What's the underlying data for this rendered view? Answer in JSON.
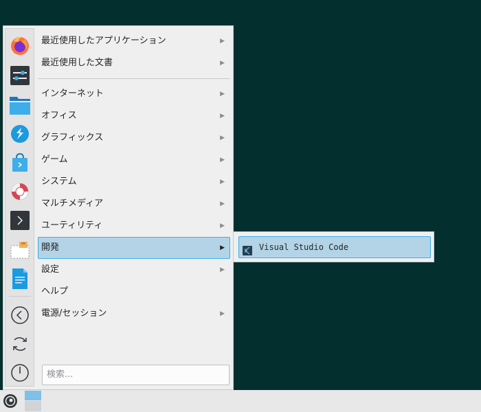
{
  "menu": {
    "items": [
      {
        "label": "最近使用したアプリケーション",
        "arrow": "▶"
      },
      {
        "label": "最近使用した文書",
        "arrow": "▶"
      },
      {
        "label": "インターネット",
        "arrow": "▶"
      },
      {
        "label": "オフィス",
        "arrow": "▶"
      },
      {
        "label": "グラフィックス",
        "arrow": "▶"
      },
      {
        "label": "ゲーム",
        "arrow": "▶"
      },
      {
        "label": "システム",
        "arrow": "▶"
      },
      {
        "label": "マルチメディア",
        "arrow": "▶"
      },
      {
        "label": "ユーティリティ",
        "arrow": "▶"
      },
      {
        "label": "開発",
        "arrow": "▶"
      },
      {
        "label": "設定",
        "arrow": "▶"
      },
      {
        "label": "ヘルプ"
      },
      {
        "label": "電源/セッション",
        "arrow": "▶"
      }
    ],
    "search_placeholder": "検索..."
  },
  "submenu": {
    "items": [
      {
        "label": "Visual Studio Code"
      }
    ]
  },
  "favorites": {
    "apps": [
      "firefox-icon",
      "settings-icon",
      "file-manager-icon",
      "discover-icon",
      "store-icon",
      "help-lifebuoy-icon",
      "terminal-icon",
      "screenshot-icon",
      "text-editor-icon"
    ],
    "session": [
      "logout-icon",
      "restart-icon",
      "shutdown-icon"
    ]
  },
  "colors": {
    "desktop": "#03302f",
    "menu_bg": "#efefef",
    "highlight": "#b3d3e6",
    "highlight_border": "#3daee9"
  }
}
